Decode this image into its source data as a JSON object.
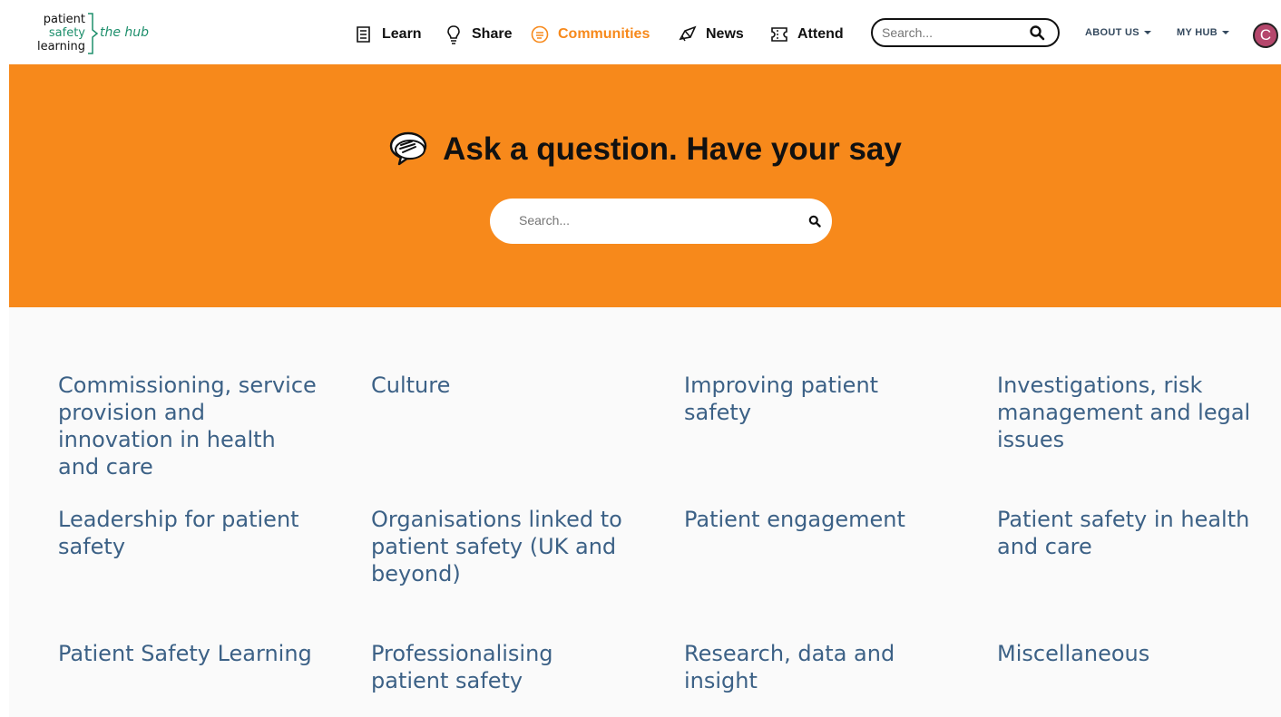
{
  "logo": {
    "line1": "patient",
    "line2": "safety",
    "line3": "learning",
    "tagline": "the hub"
  },
  "nav": [
    {
      "label": "Learn",
      "icon": "book-icon"
    },
    {
      "label": "Share",
      "icon": "lightbulb-icon"
    },
    {
      "label": "Communities",
      "icon": "chat-bubble-icon",
      "active": true
    },
    {
      "label": "News",
      "icon": "megaphone-icon"
    },
    {
      "label": "Attend",
      "icon": "ticket-icon"
    }
  ],
  "top_search": {
    "placeholder": "Search..."
  },
  "about_us": "ABOUT US",
  "my_hub": "MY HUB",
  "avatar_initial": "C",
  "hero": {
    "title": "Ask a question. Have your say",
    "search_placeholder": "Search..."
  },
  "categories": [
    "Commissioning, service provision and innovation in health and care",
    "Culture",
    "Improving patient safety",
    "Investigations, risk management and legal issues",
    "Leadership for patient safety",
    "Organisations linked to patient safety (UK and beyond)",
    "Patient engagement",
    "Patient safety in health and care",
    "Patient Safety Learning",
    "Professionalising patient safety",
    "Research, data and insight",
    "Miscellaneous"
  ],
  "colors": {
    "accent": "#f7891b",
    "link": "#3c6186",
    "brand_green": "#1e8f6c",
    "avatar": "#b5476c"
  }
}
